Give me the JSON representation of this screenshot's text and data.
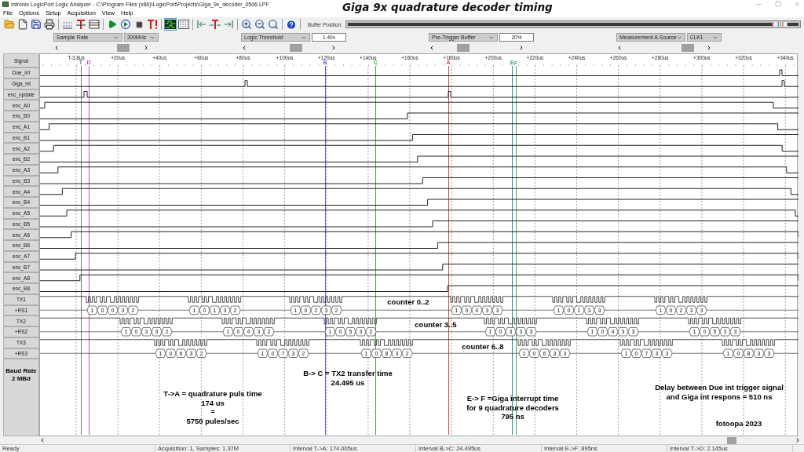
{
  "window": {
    "title": "Intronix LogicPort Logic Analyzer - C:\\Program Files (x86)\\LogicPort\\Projects\\Giga_9x_decoder_0506.LPF",
    "overlay_title": "Giga 9x quadrature decoder timing"
  },
  "menu": [
    "File",
    "Options",
    "Setup",
    "Acquisition",
    "View",
    "Help"
  ],
  "toolbar": {
    "views": [
      {
        "selected": true
      },
      {
        "selected": false
      }
    ],
    "buffer_label": "Buffer Position:"
  },
  "controls": [
    {
      "selector": "Sample Rate",
      "value": {
        "kind": "dropdown",
        "text": "200MHz"
      },
      "slider": {
        "level": 0.82
      }
    },
    {
      "selector": "Logic Threshold",
      "value": {
        "kind": "input",
        "text": "1.40v"
      },
      "slider": {
        "level": 0.6
      }
    },
    {
      "selector": "Pre-Trigger Buffer",
      "value": {
        "kind": "input",
        "text": "20%"
      },
      "slider": {
        "level": 0.3
      }
    },
    {
      "selector": "Measurement A Source",
      "value": {
        "kind": "dropdown",
        "text": "CLK1"
      },
      "slider": {
        "level": 0.85
      }
    }
  ],
  "waveform": {
    "header": "Signal",
    "ruler": [
      "T-3.8us",
      "+20us",
      "+40us",
      "+60us",
      "+80us",
      "+100us",
      "+120us",
      "+140us",
      "+160us",
      "+180us",
      "+200us",
      "+220us",
      "+240us",
      "+260us",
      "+280us",
      "+300us",
      "+320us",
      "+340us"
    ],
    "markers": [
      {
        "label": "T",
        "color": "#707070"
      },
      {
        "label": "D",
        "color": "#e040c0"
      },
      {
        "label": "B",
        "color": "#6060e0"
      },
      {
        "label": "C",
        "color": "#40a040"
      },
      {
        "label": "A",
        "color": "#e03c3c"
      },
      {
        "label": "E",
        "color": "#20a0a0"
      },
      {
        "label": "F",
        "color": "#40b060"
      }
    ],
    "signals": [
      {
        "name": "Due_int",
        "kind": "line"
      },
      {
        "name": "Giga_int",
        "kind": "line"
      },
      {
        "name": "enc_update",
        "kind": "line"
      },
      {
        "name": "enc_A0",
        "kind": "line"
      },
      {
        "name": "enc_B0",
        "kind": "line"
      },
      {
        "name": "enc_A1",
        "kind": "line"
      },
      {
        "name": "enc_B1",
        "kind": "line"
      },
      {
        "name": "enc_A2",
        "kind": "line"
      },
      {
        "name": "enc_B2",
        "kind": "line"
      },
      {
        "name": "enc_A3",
        "kind": "line"
      },
      {
        "name": "enc_B3",
        "kind": "line"
      },
      {
        "name": "enc_A4",
        "kind": "line"
      },
      {
        "name": "enc_B4",
        "kind": "line"
      },
      {
        "name": "enc_A5",
        "kind": "line"
      },
      {
        "name": "enc_B5",
        "kind": "line"
      },
      {
        "name": "enc_A6",
        "kind": "line"
      },
      {
        "name": "enc_B6",
        "kind": "line"
      },
      {
        "name": "enc_A7",
        "kind": "line"
      },
      {
        "name": "enc_B7",
        "kind": "line"
      },
      {
        "name": "enc_A8",
        "kind": "line"
      },
      {
        "name": "enc_B8",
        "kind": "line"
      },
      {
        "name": "TX1",
        "kind": "serial"
      },
      {
        "name": "+RS1",
        "kind": "bus",
        "frames": [
          [
            "1",
            "0",
            "0",
            "3",
            "2"
          ],
          [
            "1",
            "0",
            "1",
            "3",
            "2"
          ],
          [
            "1",
            "0",
            "2",
            "3",
            "2"
          ],
          [
            "1",
            "0",
            "0",
            "3",
            "3"
          ],
          [
            "1",
            "0",
            "1",
            "3",
            "3"
          ],
          [
            "1",
            "0",
            "2",
            "3",
            "3"
          ]
        ]
      },
      {
        "name": "TX2",
        "kind": "serial"
      },
      {
        "name": "+RS2",
        "kind": "bus",
        "frames": [
          [
            "1",
            "0",
            "3",
            "3",
            "2"
          ],
          [
            "1",
            "0",
            "4",
            "3",
            "2"
          ],
          [
            "1",
            "0",
            "5",
            "3",
            "2"
          ],
          [
            "1",
            "0",
            "3",
            "3",
            "3"
          ],
          [
            "1",
            "0",
            "4",
            "3",
            "3"
          ],
          [
            "1",
            "0",
            "5",
            "3",
            "3"
          ]
        ]
      },
      {
        "name": "TX3",
        "kind": "serial"
      },
      {
        "name": "+RS3",
        "kind": "bus",
        "frames": [
          [
            "1",
            "0",
            "6",
            "3",
            "2"
          ],
          [
            "1",
            "0",
            "7",
            "3",
            "2"
          ],
          [
            "1",
            "0",
            "8",
            "3",
            "2"
          ],
          [
            "1",
            "0",
            "6",
            "3",
            "3"
          ],
          [
            "1",
            "0",
            "7",
            "3",
            "3"
          ],
          [
            "1",
            "0",
            "8",
            "3",
            "3"
          ]
        ]
      }
    ],
    "footer_label": "Baud Rate\n2 MBd",
    "annotations": [
      "counter 0..2",
      "counter 3..5",
      "counter 6..8",
      "B-> C = TX2 transfer time\n24.495 us",
      "T->A = quadrature puls time\n174 us\n=\n5750 pules/sec",
      "E-> F =Giga interrupt time\nfor 9 quadrature decoders\n795 ns",
      "Delay between Due int trigger signal\nand Giga int respons = 510 ns",
      "fotoopa 2023"
    ]
  },
  "status_bar": [
    "Ready",
    "Acquisition: 1, Samples: 1.37M",
    "Interval T->A: 174.005us",
    "Interval B->C: 24.495us",
    "Interval E->F: 895ns",
    "Interval T->D: 2.145us"
  ]
}
